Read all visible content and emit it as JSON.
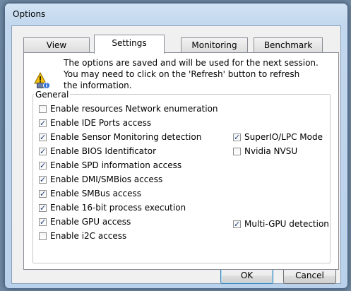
{
  "window": {
    "title": "Options"
  },
  "tabs": [
    {
      "label": "View",
      "active": false
    },
    {
      "label": "Settings",
      "active": true
    },
    {
      "label": "Monitoring",
      "active": false
    },
    {
      "label": "Benchmark",
      "active": false
    }
  ],
  "info": {
    "icon": "info-settings-icon",
    "line1": "The options are saved and will be used for the next session.",
    "line2": "You may need to click on the 'Refresh' button to refresh",
    "line3": "the information."
  },
  "general": {
    "legend": "General",
    "options": [
      {
        "label": "Enable resources Network enumeration",
        "checked": false
      },
      {
        "label": "Enable IDE Ports access",
        "checked": true
      },
      {
        "label": "Enable Sensor Monitoring detection",
        "checked": true
      },
      {
        "label": "Enable BIOS Identificator",
        "checked": true
      },
      {
        "label": "Enable SPD information access",
        "checked": true
      },
      {
        "label": "Enable DMI/SMBios access",
        "checked": true
      },
      {
        "label": "Enable SMBus access",
        "checked": true
      },
      {
        "label": "Enable 16-bit process execution",
        "checked": true
      },
      {
        "label": "Enable GPU access",
        "checked": true
      },
      {
        "label": "Enable i2C access",
        "checked": false
      }
    ],
    "right_options": [
      {
        "label": "SuperIO/LPC Mode",
        "checked": true
      },
      {
        "label": "Nvidia NVSU",
        "checked": false
      },
      {
        "label": "Multi-GPU detection",
        "checked": true
      }
    ]
  },
  "buttons": {
    "ok": "OK",
    "cancel": "Cancel"
  }
}
